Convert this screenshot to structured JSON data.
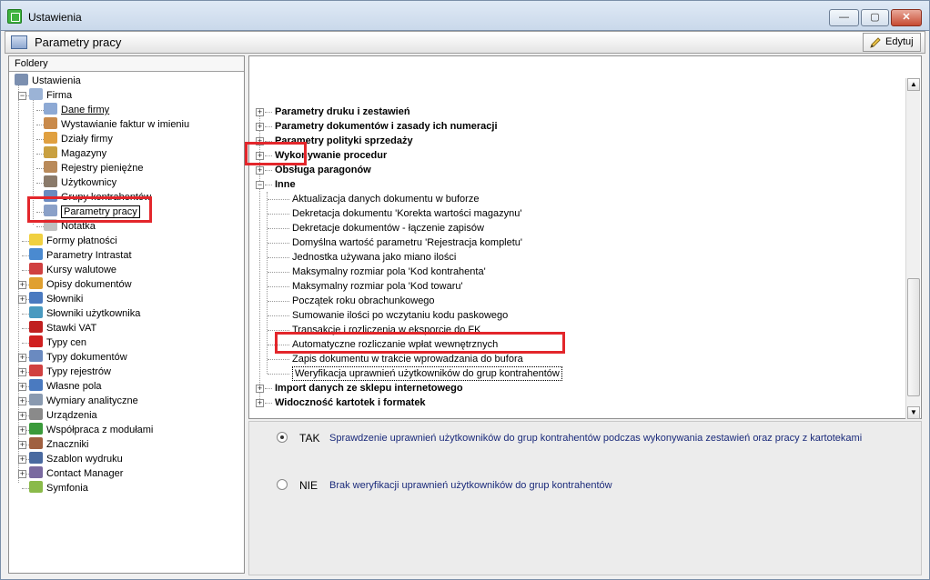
{
  "window": {
    "title": "Ustawienia",
    "min_label": "—",
    "max_label": "▢",
    "close_label": "✕"
  },
  "header": {
    "title": "Parametry pracy",
    "edit_label": "Edytuj"
  },
  "folders": {
    "header": "Foldery",
    "items": [
      {
        "label": "Ustawienia",
        "icon": "tools-icon"
      },
      {
        "label": "Firma",
        "icon": "company-icon"
      },
      {
        "label": "Dane firmy",
        "icon": "company-data-icon"
      },
      {
        "label": "Wystawianie faktur w imieniu",
        "icon": "person-icon"
      },
      {
        "label": "Działy firmy",
        "icon": "departments-icon"
      },
      {
        "label": "Magazyny",
        "icon": "warehouse-icon"
      },
      {
        "label": "Rejestry pieniężne",
        "icon": "money-icon"
      },
      {
        "label": "Użytkownicy",
        "icon": "users-icon"
      },
      {
        "label": "Grupy kontrahentów",
        "icon": "groups-icon"
      },
      {
        "label": "Parametry pracy",
        "icon": "params-icon"
      },
      {
        "label": "Notatka",
        "icon": "note-icon"
      },
      {
        "label": "Formy płatności",
        "icon": "payment-icon"
      },
      {
        "label": "Parametry Intrastat",
        "icon": "intrastat-icon"
      },
      {
        "label": "Kursy walutowe",
        "icon": "currency-chart-icon"
      },
      {
        "label": "Opisy dokumentów",
        "icon": "doc-desc-icon"
      },
      {
        "label": "Słowniki",
        "icon": "dictionary-icon"
      },
      {
        "label": "Słowniki użytkownika",
        "icon": "user-dictionary-icon"
      },
      {
        "label": "Stawki VAT",
        "icon": "vat-icon"
      },
      {
        "label": "Typy cen",
        "icon": "price-type-icon"
      },
      {
        "label": "Typy dokumentów",
        "icon": "doc-type-icon"
      },
      {
        "label": "Typy rejestrów",
        "icon": "register-type-icon"
      },
      {
        "label": "Własne pola",
        "icon": "custom-fields-icon"
      },
      {
        "label": "Wymiary analityczne",
        "icon": "analytics-icon"
      },
      {
        "label": "Urządzenia",
        "icon": "devices-icon"
      },
      {
        "label": "Współpraca z modułami",
        "icon": "modules-icon"
      },
      {
        "label": "Znaczniki",
        "icon": "markers-icon"
      },
      {
        "label": "Szablon wydruku",
        "icon": "print-template-icon"
      },
      {
        "label": "Contact Manager",
        "icon": "contact-manager-icon"
      },
      {
        "label": "Symfonia",
        "icon": "symfonia-icon"
      }
    ]
  },
  "params": {
    "items": [
      {
        "label": "Parametry druku i zestawień"
      },
      {
        "label": "Parametry dokumentów i zasady ich numeracji"
      },
      {
        "label": "Parametry polityki sprzedaży"
      },
      {
        "label": "Wykonywanie procedur"
      },
      {
        "label": "Obsługa paragonów"
      },
      {
        "label": "Inne"
      },
      {
        "label": "Aktualizacja danych dokumentu w buforze"
      },
      {
        "label": "Dekretacja dokumentu 'Korekta wartości magazynu'"
      },
      {
        "label": "Dekretacje dokumentów - łączenie zapisów"
      },
      {
        "label": "Domyślna wartość parametru 'Rejestracja kompletu'"
      },
      {
        "label": "Jednostka używana jako miano ilości"
      },
      {
        "label": "Maksymalny rozmiar pola 'Kod kontrahenta'"
      },
      {
        "label": "Maksymalny rozmiar pola 'Kod towaru'"
      },
      {
        "label": "Początek roku obrachunkowego"
      },
      {
        "label": "Sumowanie ilości po wczytaniu kodu paskowego"
      },
      {
        "label": "Transakcje i rozliczenia w eksporcie do FK"
      },
      {
        "label": "Automatyczne rozliczanie wpłat wewnętrznych"
      },
      {
        "label": "Zapis dokumentu w trakcie wprowadzania do bufora"
      },
      {
        "label": "Weryfikacja uprawnień użytkowników  do grup kontrahentów"
      },
      {
        "label": "Import danych ze sklepu internetowego"
      },
      {
        "label": "Widoczność kartotek i formatek"
      }
    ]
  },
  "options": {
    "tak": {
      "label": "TAK",
      "desc": "Sprawdzenie uprawnień użytkowników do grup kontrahentów podczas wykonywania zestawień oraz pracy z kartotekami",
      "selected": true
    },
    "nie": {
      "label": "NIE",
      "desc": "Brak weryfikacji uprawnień użytkowników do grup kontrahentów",
      "selected": false
    }
  },
  "colors": {
    "highlight": "#e3262b",
    "desc_text": "#1a2a7a"
  }
}
